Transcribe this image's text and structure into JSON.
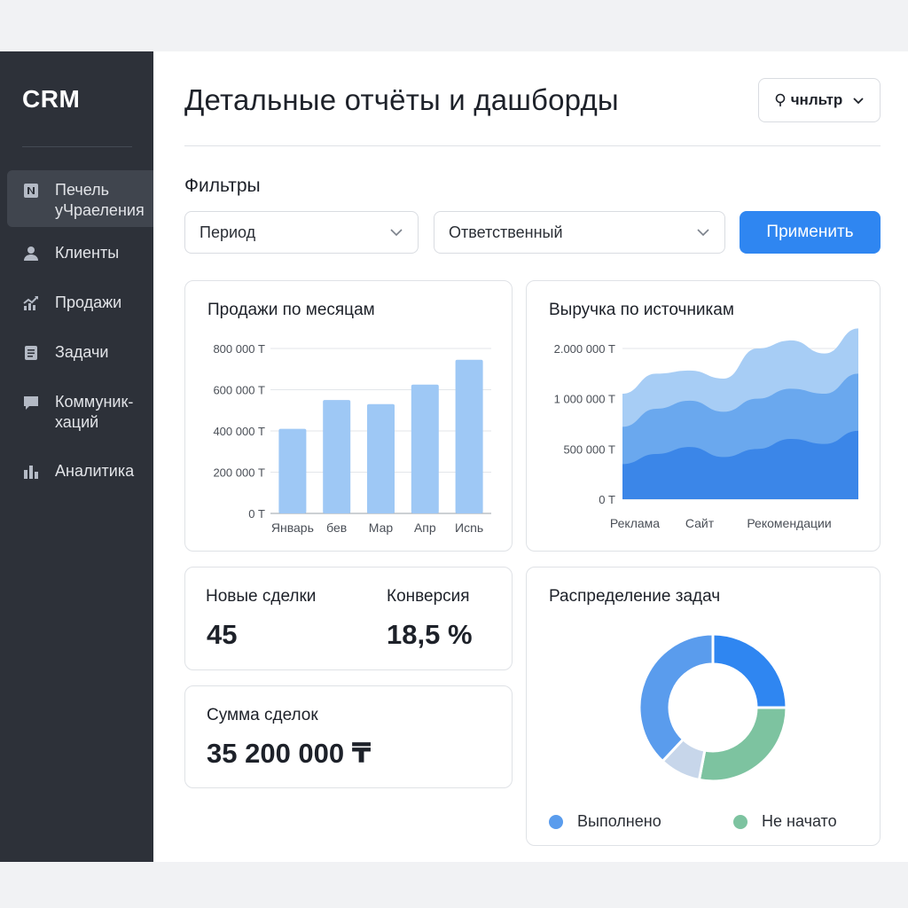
{
  "sidebar": {
    "brand": "CRM",
    "items": [
      {
        "line1": "Печель",
        "line2": "уЧраеления",
        "icon": "notion-icon"
      },
      {
        "line1": "Клиенты",
        "line2": "",
        "icon": "user-icon"
      },
      {
        "line1": "Продажи",
        "line2": "",
        "icon": "trend-chart-icon"
      },
      {
        "line1": "Задачи",
        "line2": "",
        "icon": "document-icon"
      },
      {
        "line1": "Коммуник-",
        "line2": "хаций",
        "icon": "chat-icon"
      },
      {
        "line1": "Аналитика",
        "line2": "",
        "icon": "bar-chart-icon"
      }
    ]
  },
  "header": {
    "title": "Детальные отчёты и дашборды",
    "filter_button": "чнльтр"
  },
  "filters": {
    "title": "Фильтры",
    "period": "Период",
    "responsible": "Ответственный",
    "apply": "Применить"
  },
  "colors": {
    "accent": "#2f86f1",
    "bar": "#9ec8f5",
    "area_light": "#a7cdf5",
    "area_mid": "#6aa8ee",
    "area_dark": "#3b86e8",
    "donut_done": "#2f86f1",
    "donut_not_started": "#7dc3a0",
    "donut_other": "#c7d6ea",
    "donut_light": "#5a9ced"
  },
  "sales_card": {
    "title": "Продажи по месяцам"
  },
  "revenue_card": {
    "title": "Выручка по источникам"
  },
  "kpi": {
    "new_deals_label": "Новые сделки",
    "new_deals_value": "45",
    "conversion_label": "Конверсия",
    "conversion_value": "18,5 %",
    "sum_label": "Сумма сделок",
    "sum_value": "35 200 000 ₸"
  },
  "tasks_card": {
    "title": "Распределение задач",
    "legend_done": "Выполнено",
    "legend_not_started": "Не начато"
  },
  "chart_data": [
    {
      "type": "bar",
      "title": "Продажи по месяцам",
      "categories": [
        "Январь",
        "бев",
        "Мар",
        "Апр",
        "Исnь"
      ],
      "values": [
        410000,
        550000,
        530000,
        625000,
        745000
      ],
      "yticks": [
        "0 Т",
        "200 000 Т",
        "400 000 Т",
        "600 000 Т",
        "800 000 Т"
      ],
      "ylim": [
        0,
        800000
      ],
      "grid": true
    },
    {
      "type": "area",
      "title": "Выручка по источникам",
      "x_labels": [
        "Реклама",
        "Сайт",
        "Рекомендации"
      ],
      "yticks": [
        "0 Т",
        "500 000 Т",
        "1 000 000 Т",
        "2.000 000 Т"
      ],
      "ytick_values": [
        0,
        500000,
        1000000,
        1500000
      ],
      "ylim": [
        0,
        1500000
      ],
      "grid": true,
      "series": [
        {
          "values": [
            350000,
            450000,
            520000,
            420000,
            500000,
            600000,
            550000,
            680000
          ]
        },
        {
          "values": [
            720000,
            900000,
            980000,
            870000,
            1000000,
            1100000,
            1050000,
            1250000
          ]
        },
        {
          "values": [
            1050000,
            1250000,
            1280000,
            1200000,
            1500000,
            1580000,
            1450000,
            1700000
          ]
        }
      ]
    },
    {
      "type": "pie",
      "title": "Распределение задач",
      "legend": [
        "Выполнено",
        "Не начато"
      ],
      "slices": [
        {
          "value": 25,
          "color": "#2f86f1"
        },
        {
          "value": 28,
          "color": "#7dc3a0"
        },
        {
          "value": 9,
          "color": "#c7d6ea"
        },
        {
          "value": 38,
          "color": "#5a9ced"
        }
      ]
    }
  ]
}
